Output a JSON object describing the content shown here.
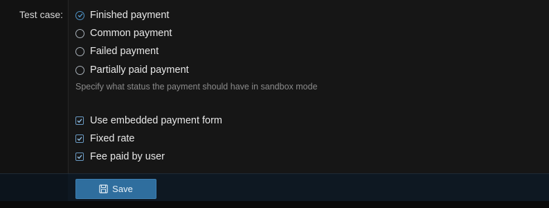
{
  "test_case": {
    "label": "Test case:",
    "options": [
      {
        "label": "Finished payment",
        "checked": true
      },
      {
        "label": "Common payment",
        "checked": false
      },
      {
        "label": "Failed payment",
        "checked": false
      },
      {
        "label": "Partially paid payment",
        "checked": false
      }
    ],
    "hint": "Specify what status the payment should have in sandbox mode"
  },
  "settings": {
    "options": [
      {
        "label": "Use embedded payment form",
        "checked": true
      },
      {
        "label": "Fixed rate",
        "checked": true
      },
      {
        "label": "Fee paid by user",
        "checked": true
      }
    ]
  },
  "footer": {
    "save_label": "Save",
    "save_icon": "floppy-disk-icon"
  },
  "colors": {
    "accent": "#4f95c9",
    "button": "#2f6e9e",
    "background": "#161616"
  }
}
